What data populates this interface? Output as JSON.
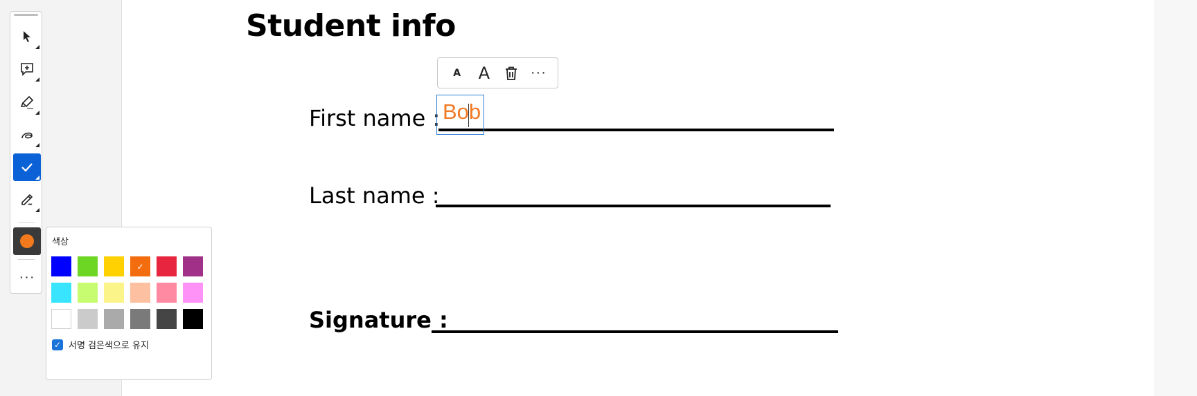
{
  "document": {
    "title": "Student info",
    "fields": {
      "first_name_label": "First name :",
      "first_name_value": "Bob",
      "last_name_label": "Last name :",
      "signature_label": "Signature :"
    }
  },
  "text_toolbar": {
    "decrease_font_label": "A",
    "increase_font_label": "A",
    "delete_icon": "trash-icon",
    "more_label": "···"
  },
  "left_toolbar": {
    "tools": [
      {
        "name": "select",
        "icon": "cursor-arrow-icon"
      },
      {
        "name": "comment",
        "icon": "add-comment-icon"
      },
      {
        "name": "highlight",
        "icon": "highlighter-icon"
      },
      {
        "name": "draw",
        "icon": "freehand-loop-icon"
      },
      {
        "name": "checkmark",
        "icon": "checkmark-icon",
        "active": true
      },
      {
        "name": "sign",
        "icon": "pen-sign-icon"
      }
    ],
    "current_color": "#f27a1c",
    "more_label": "···"
  },
  "color_popup": {
    "title": "색상",
    "swatches": [
      [
        "#0000ff",
        "#6dd624",
        "#ffd100",
        "#f36d0f",
        "#e8253e",
        "#a03088"
      ],
      [
        "#39e4ff",
        "#c8fc70",
        "#fbf488",
        "#fdc0a0",
        "#ff8aa2",
        "#ff92f7"
      ],
      [
        "#ffffff",
        "#cbcbcb",
        "#aaaaaa",
        "#7a7a7a",
        "#454545",
        "#000000"
      ]
    ],
    "selected_swatch": "#f36d0f",
    "keep_signature_black_label": "서명 검은색으로 유지",
    "keep_signature_black_checked": true
  },
  "colors": {
    "accent": "#0b62d6",
    "text_value": "#f07a26"
  }
}
